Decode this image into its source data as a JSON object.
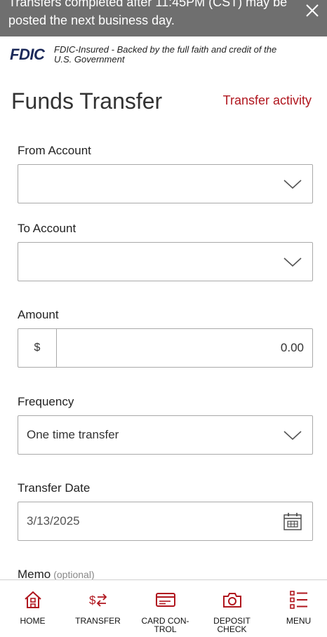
{
  "banner": {
    "message": "Transfers completed after 11:45PM (CST) may be posted the next business day."
  },
  "fdic": {
    "logo": "FDIC",
    "text": "FDIC-Insured - Backed by the full faith and credit of the U.S. Government"
  },
  "header": {
    "title": "Funds Transfer",
    "activity_link": "Transfer activity"
  },
  "form": {
    "from_label": "From Account",
    "from_value": "",
    "to_label": "To Account",
    "to_value": "",
    "amount_label": "Amount",
    "currency_symbol": "$",
    "amount_value": "0.00",
    "frequency_label": "Frequency",
    "frequency_value": "One time transfer",
    "date_label": "Transfer Date",
    "date_value": "3/13/2025",
    "memo_label": "Memo",
    "memo_optional": "(optional)"
  },
  "nav": {
    "items": [
      {
        "label": "HOME",
        "icon": "home-icon"
      },
      {
        "label": "TRANSFER",
        "icon": "transfer-icon"
      },
      {
        "label": "CARD CON-\nTROL",
        "icon": "card-icon"
      },
      {
        "label": "DEPOSIT\nCHECK",
        "icon": "camera-icon"
      },
      {
        "label": "MENU",
        "icon": "menu-icon"
      }
    ]
  },
  "colors": {
    "accent": "#b0161e",
    "banner_bg": "#6f6f6f",
    "fdic_blue": "#1c2a5a"
  }
}
